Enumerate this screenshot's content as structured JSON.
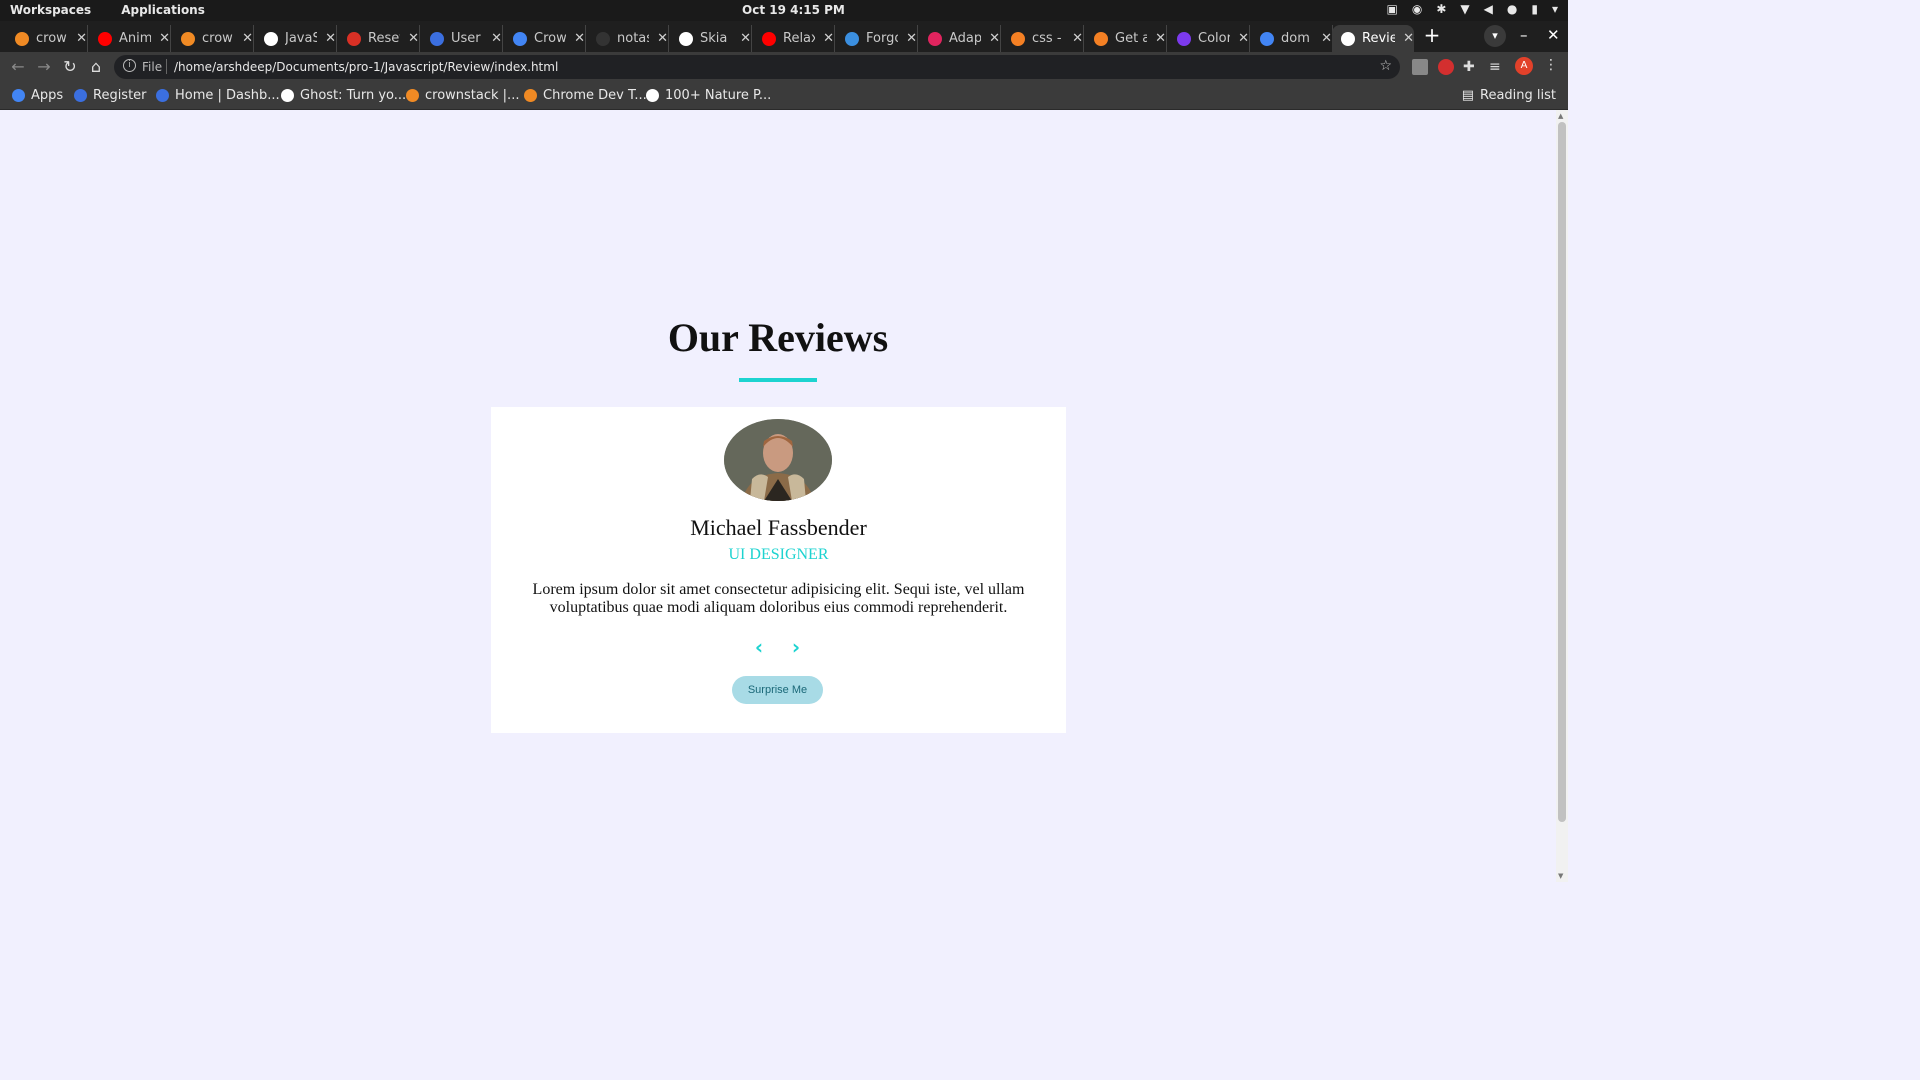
{
  "system_bar": {
    "workspaces": "Workspaces",
    "applications": "Applications",
    "clock": "Oct 19   4:15 PM"
  },
  "tabs": [
    {
      "title": "crow",
      "icon": "crownstack-icon",
      "color": "#f08a24"
    },
    {
      "title": "Anim",
      "icon": "youtube-icon",
      "color": "#ff0000"
    },
    {
      "title": "crow",
      "icon": "crownstack-icon",
      "color": "#f08a24"
    },
    {
      "title": "JavaS",
      "icon": "bookmark-icon",
      "color": "#ffffff"
    },
    {
      "title": "Reset",
      "icon": "gmail-icon",
      "color": "#d93025"
    },
    {
      "title": "User",
      "icon": "k-icon",
      "color": "#3b6fe0"
    },
    {
      "title": "Crow",
      "icon": "calendar-icon",
      "color": "#4285f4"
    },
    {
      "title": "notas",
      "icon": "github-icon",
      "color": "#333333"
    },
    {
      "title": "Skia",
      "icon": "globe-icon",
      "color": "#ffffff"
    },
    {
      "title": "Relax",
      "icon": "youtube-icon",
      "color": "#ff0000"
    },
    {
      "title": "Forgo",
      "icon": "k-icon",
      "color": "#3b8fe0"
    },
    {
      "title": "Adap",
      "icon": "asterisk-icon",
      "color": "#e0245e"
    },
    {
      "title": "css -",
      "icon": "stackoverflow-icon",
      "color": "#f48024"
    },
    {
      "title": "Get a",
      "icon": "stackoverflow-icon",
      "color": "#f48024"
    },
    {
      "title": "Color",
      "icon": "c-icon",
      "color": "#7c3aed"
    },
    {
      "title": "dom",
      "icon": "google-icon",
      "color": "#4285f4"
    },
    {
      "title": "Revie",
      "icon": "globe-icon",
      "color": "#ffffff",
      "active": true
    }
  ],
  "omnibox": {
    "scheme_label": "File",
    "url": "/home/arshdeep/Documents/pro-1/Javascript/Review/index.html"
  },
  "profile_initial": "A",
  "bookmarks": [
    {
      "label": "Apps",
      "icon": "apps-grid-icon",
      "color": "#4285f4"
    },
    {
      "label": "Register",
      "icon": "k-icon",
      "color": "#3b6fe0"
    },
    {
      "label": "Home | Dashb...",
      "icon": "k-icon",
      "color": "#3b6fe0"
    },
    {
      "label": "Ghost: Turn yo...",
      "icon": "ghost-icon",
      "color": "#ffffff"
    },
    {
      "label": "crownstack |...",
      "icon": "crownstack-icon",
      "color": "#f08a24"
    },
    {
      "label": "Chrome Dev T...",
      "icon": "crownstack-icon",
      "color": "#f08a24"
    },
    {
      "label": "100+ Nature P...",
      "icon": "unsplash-icon",
      "color": "#ffffff"
    }
  ],
  "reading_list": "Reading list",
  "page": {
    "heading": "Our Reviews",
    "accent_color": "#1dd3d0",
    "review": {
      "name": "Michael Fassbender",
      "role": "UI DESIGNER",
      "text": "Lorem ipsum dolor sit amet consectetur adipisicing elit. Sequi iste, vel ullam voluptatibus quae modi aliquam doloribus eius commodi reprehenderit."
    },
    "prev_symbol": "‹",
    "next_symbol": "›",
    "surprise_label": "Surprise Me"
  }
}
